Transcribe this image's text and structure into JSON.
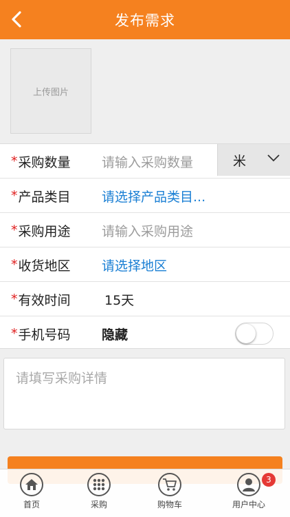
{
  "header": {
    "title": "发布需求"
  },
  "upload": {
    "label": "上传图片"
  },
  "form": {
    "required_mark": "*",
    "rows": [
      {
        "label": "采购数量",
        "value": "请输入采购数量",
        "kind": "placeholder"
      },
      {
        "label": "产品类目",
        "value": "请选择产品类目...",
        "kind": "link"
      },
      {
        "label": "采购用途",
        "value": "请输入采购用途",
        "kind": "placeholder"
      },
      {
        "label": "收货地区",
        "value": "请选择地区",
        "kind": "link"
      },
      {
        "label": "有效时间",
        "value": "15天",
        "kind": "plain"
      },
      {
        "label": "手机号码",
        "value": "隐藏",
        "kind": "bold"
      }
    ],
    "unit": {
      "value": "米",
      "icon": "chevron-down-icon"
    },
    "hide_phone_toggle": {
      "on": false
    }
  },
  "details": {
    "placeholder": "请填写采购详情"
  },
  "tabbar": {
    "items": [
      {
        "label": "首页",
        "icon": "home-icon"
      },
      {
        "label": "采购",
        "icon": "grid-icon"
      },
      {
        "label": "购物车",
        "icon": "cart-icon"
      },
      {
        "label": "用户中心",
        "icon": "user-icon"
      }
    ],
    "badge": "3"
  },
  "colors": {
    "accent": "#f5811f",
    "link": "#1a7fd4",
    "required": "#e02020",
    "badge": "#e53935"
  }
}
